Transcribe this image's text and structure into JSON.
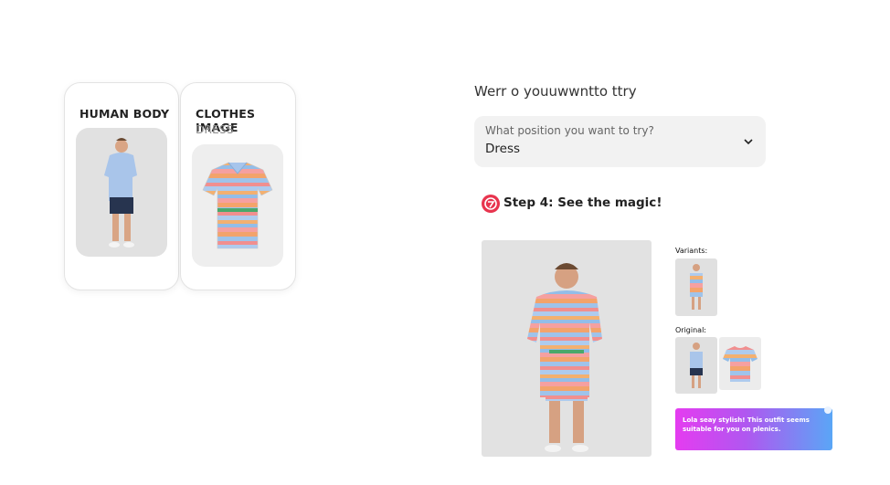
{
  "cards": {
    "human": {
      "title": "HUMAN BODY"
    },
    "clothes": {
      "title": "CLOTHES IMAGE",
      "subtitle": "DRESS"
    }
  },
  "try_section": {
    "heading": "Werr o youuwwntto ttry",
    "select": {
      "label": "What position you want to try?",
      "value": "Dress"
    }
  },
  "step": {
    "label": "Step 4: See the magic!"
  },
  "result": {
    "variants_label": "Variants:",
    "original_label": "Original:"
  },
  "toast": {
    "message": "Lola seay stylish! This outfit seems suitable for you on plenics."
  },
  "colors": {
    "accent": "#e8344e",
    "select_bg": "#f2f2f2",
    "toast_start": "#e53cf0",
    "toast_end": "#5aa6f6"
  },
  "icons": {
    "chevron": "chevron-down-icon",
    "step": "magic-step-icon",
    "close": "close-icon"
  }
}
